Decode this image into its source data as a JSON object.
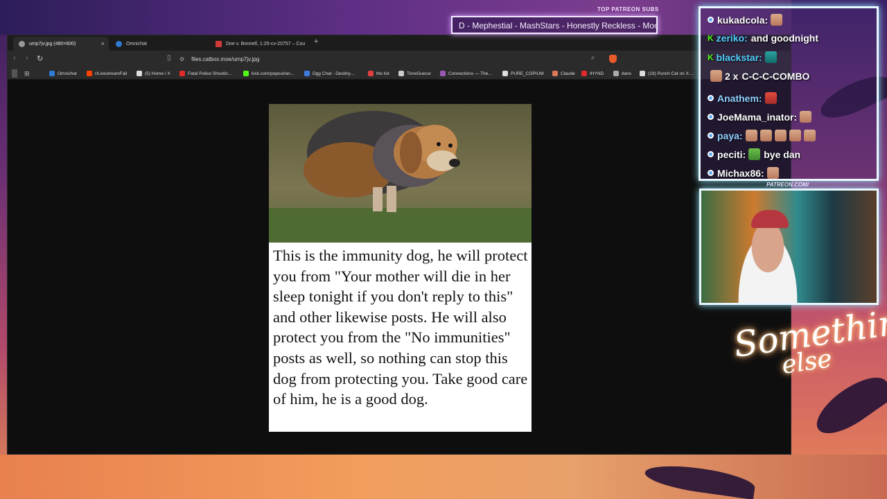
{
  "browser": {
    "tabs": [
      {
        "label": "ump7jv.jpg (480×600)",
        "active": true,
        "icon": "image-icon",
        "closable": true
      },
      {
        "label": "Omnichat",
        "active": false,
        "icon": "omnichat-icon"
      },
      {
        "label": "Doe v. Bonnell, 1:25-cv-20757 – Cou",
        "active": false,
        "icon": "pdf-icon"
      }
    ],
    "new_tab_glyph": "+",
    "url": "files.catbox.moe/ump7jv.jpg",
    "bookmarks": [
      {
        "label": "Omnichat",
        "icon_color": "#2f7bd6"
      },
      {
        "label": "r/LivestreamFail",
        "icon_color": "#ff4500"
      },
      {
        "label": "(5) Home / X",
        "icon_color": "#dddddd"
      },
      {
        "label": "Fatal Police Shootin...",
        "icon_color": "#e02b2b"
      },
      {
        "label": "kick.com/popout/an...",
        "icon_color": "#53fc18"
      },
      {
        "label": "Dgg Chat - Destiny....",
        "icon_color": "#3d7be0"
      },
      {
        "label": "the list",
        "icon_color": "#e04040"
      },
      {
        "label": "TimeGuessr",
        "icon_color": "#cccccc"
      },
      {
        "label": "Connections — The...",
        "icon_color": "#9b59b6"
      },
      {
        "label": "PURE_COPIUM",
        "icon_color": "#dddddd"
      },
      {
        "label": "Claude",
        "icon_color": "#d97757"
      },
      {
        "label": "IHYND",
        "icon_color": "#e02b2b"
      },
      {
        "label": "dans",
        "icon_color": "#aaaaaa"
      },
      {
        "label": "(19) Punch Cat on X:...",
        "icon_color": "#dddddd"
      }
    ],
    "image": {
      "caption": "This is the immunity dog, he will protect you from \"Your mother will die in her sleep tonight if you don't reply to this\" and other likewise posts. He will also protect you from the \"No immunities\" posts as well, so nothing can stop this dog from protecting you. Take good care of him, he is a good dog."
    }
  },
  "overlay": {
    "patreon_label": "TOP PATREON SUBS",
    "patreon_ticker": "D - Mephestial - MashStars - Honestly Reckless - Moot E",
    "patreon_url": "PATREON.COM/",
    "signature_line1": "Something",
    "signature_line2": "else",
    "chat": [
      {
        "user": "kukadcola:",
        "message": "",
        "platform": "omnichat",
        "user_color": "#ffffff",
        "emotes": [
          "face"
        ]
      },
      {
        "user": "zeriko:",
        "message": "and goodnight",
        "platform": "kick",
        "user_color": "#53d1ff",
        "emotes": []
      },
      {
        "user": "blackstar:",
        "message": "",
        "platform": "kick",
        "user_color": "#53d1ff",
        "emotes": [
          "blue"
        ]
      },
      {
        "user": "2 x",
        "message": "C-C-C-COMBO",
        "platform": "combo",
        "user_color": "#ffffff",
        "emotes": []
      },
      {
        "user": "Anathem:",
        "message": "",
        "platform": "omnichat",
        "user_color": "#8fd0ff",
        "emotes": [
          "red"
        ]
      },
      {
        "user": "JoeMama_inator:",
        "message": "",
        "platform": "omnichat",
        "user_color": "#ffffff",
        "emotes": [
          "face"
        ]
      },
      {
        "user": "paya:",
        "message": "",
        "platform": "omnichat",
        "user_color": "#8fd0ff",
        "emotes": [
          "face",
          "face",
          "face",
          "face",
          "face"
        ]
      },
      {
        "user": "peciti:",
        "message": "bye dan",
        "platform": "omnichat",
        "user_color": "#ffffff",
        "emotes": [
          "green"
        ]
      },
      {
        "user": "Michax86:",
        "message": "",
        "platform": "omnichat",
        "user_color": "#ffffff",
        "emotes": [
          "face"
        ]
      }
    ]
  }
}
